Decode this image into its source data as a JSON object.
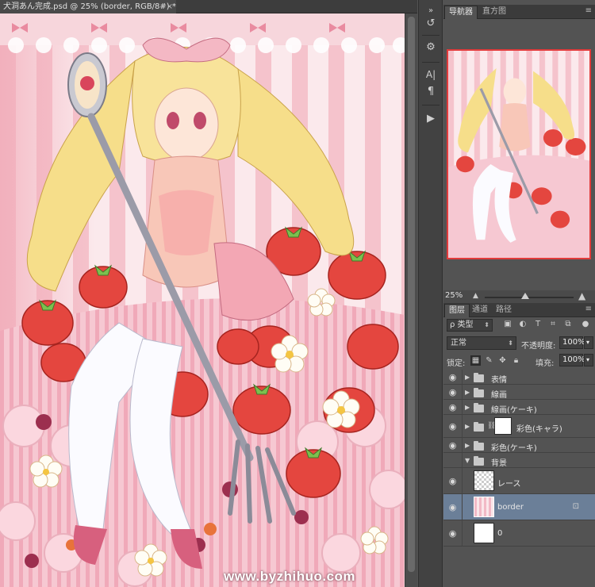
{
  "document": {
    "tab_title": "犬洞あん完成.psd @ 25% (border, RGB/8#) *",
    "close_glyph": "×",
    "watermark": "www.byzhihuo.com"
  },
  "tool_strip": {
    "icons": [
      "history-icon",
      "properties-icon",
      "character-icon",
      "paragraph-icon",
      "actions-play-icon"
    ],
    "glyphs": [
      "↺",
      "⚙",
      "A|",
      "¶",
      "▶"
    ]
  },
  "navigator": {
    "tabs": [
      "导航器",
      "直方图"
    ],
    "zoom": "25%"
  },
  "layers_panel": {
    "tabs": [
      "图层",
      "通道",
      "路径"
    ],
    "filter_type": "ρ 类型",
    "blend_mode": "正常",
    "opacity_label": "不透明度:",
    "opacity_value": "100%",
    "lock_label": "锁定:",
    "fill_label": "填充:",
    "fill_value": "100%",
    "layers": [
      {
        "name": "表情",
        "kind": "group",
        "expanded": false,
        "visible": true
      },
      {
        "name": "線画",
        "kind": "group",
        "expanded": false,
        "visible": true
      },
      {
        "name": "線画(ケーキ)",
        "kind": "group",
        "expanded": false,
        "visible": true
      },
      {
        "name": "彩色(キャラ)",
        "kind": "group-mask",
        "expanded": false,
        "visible": true
      },
      {
        "name": "彩色(ケーキ)",
        "kind": "group",
        "expanded": false,
        "visible": true
      },
      {
        "name": "背景",
        "kind": "group",
        "expanded": true,
        "visible": false
      },
      {
        "name": "レース",
        "kind": "layer",
        "visible": true
      },
      {
        "name": "border",
        "kind": "layer",
        "visible": true,
        "selected": true,
        "locked": true
      },
      {
        "name": "0",
        "kind": "layer",
        "visible": true
      }
    ]
  }
}
